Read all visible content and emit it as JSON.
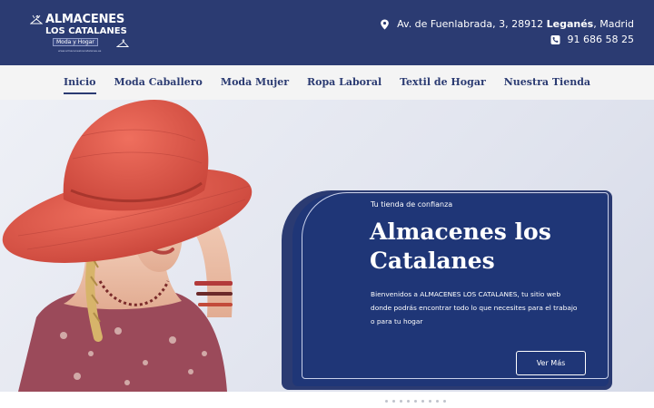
{
  "header": {
    "logo": {
      "title": "ALMACENES",
      "subtitle": "LOS CATALANES",
      "badge": "Moda y Hogar",
      "url": "www.almacenesloscatalanes.es"
    },
    "address_prefix": "Av. de Fuenlabrada, 3, 28912 ",
    "address_city": "Leganés",
    "address_suffix": ", Madrid",
    "phone": "91 686 58 25",
    "background_color": "#2b3b72"
  },
  "nav": {
    "items": [
      {
        "label": "Inicio",
        "active": true
      },
      {
        "label": "Moda Caballero",
        "active": false
      },
      {
        "label": "Moda Mujer",
        "active": false
      },
      {
        "label": "Ropa Laboral",
        "active": false
      },
      {
        "label": "Textil de Hogar",
        "active": false
      },
      {
        "label": "Nuestra Tienda",
        "active": false
      }
    ]
  },
  "hero": {
    "kicker": "Tu tienda de confianza",
    "title": "Almacenes los Catalanes",
    "text": "Bienvenidos a ALMACENES LOS CATALANES, tu sitio web donde podrás encontrar todo lo que necesites para el trabajo o para tu hogar",
    "button_label": "Ver Más",
    "panel_color": "#1f3677",
    "slides": 9
  },
  "icons": {
    "address": "map-pin-icon",
    "phone": "phone-icon",
    "logo_hanger": "hanger-icon"
  }
}
